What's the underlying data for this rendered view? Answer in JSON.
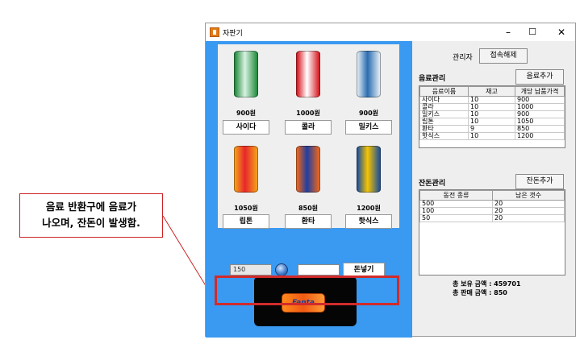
{
  "window": {
    "title": "자판기",
    "minimize": "–",
    "maximize": "☐",
    "close": "✕"
  },
  "machine": {
    "products": [
      {
        "name": "사이다",
        "price": "900원",
        "color": "#1f8a3a",
        "accent": "#d9f2e3"
      },
      {
        "name": "콜라",
        "price": "1000원",
        "color": "#d6141d",
        "accent": "#ffffff"
      },
      {
        "name": "밀키스",
        "price": "900원",
        "color": "#e4eef5",
        "accent": "#2b6cb0"
      },
      {
        "name": "립톤",
        "price": "1050원",
        "color": "#f4a21a",
        "accent": "#e8262c"
      },
      {
        "name": "환타",
        "price": "850원",
        "color": "#f2661a",
        "accent": "#1f3fa0"
      },
      {
        "name": "핫식스",
        "price": "1200원",
        "color": "#1b4f9c",
        "accent": "#f6c400"
      }
    ],
    "money_input": "150",
    "insert_button": "돈넣기",
    "returned_can_label": "Fanta"
  },
  "admin": {
    "label": "관리자",
    "disconnect_button": "접속해제"
  },
  "drinks": {
    "section_label": "음료관리",
    "add_button": "음료추가",
    "columns": [
      "음료이름",
      "재고",
      "개당 납품가격"
    ],
    "rows": [
      [
        "사이다",
        "10",
        "900"
      ],
      [
        "콜라",
        "10",
        "1000"
      ],
      [
        "밀키스",
        "10",
        "900"
      ],
      [
        "립톤",
        "10",
        "1050"
      ],
      [
        "환타",
        "9",
        "850"
      ],
      [
        "핫식스",
        "10",
        "1200"
      ]
    ]
  },
  "change": {
    "section_label": "잔돈관리",
    "add_button": "잔돈추가",
    "columns": [
      "동전 종류",
      "남은 갯수"
    ],
    "rows": [
      [
        "500",
        "20"
      ],
      [
        "100",
        "20"
      ],
      [
        "50",
        "20"
      ]
    ]
  },
  "totals": {
    "owned": "총 보유 금액 : 459701",
    "sales": "총 판매 금액 : 850"
  },
  "annotation": {
    "line1": "음료 반환구에 음료가",
    "line2": "나오며, 잔돈이 발생함."
  },
  "colors": {
    "machine_bg": "#3a99f0",
    "highlight": "#d12b2b"
  }
}
